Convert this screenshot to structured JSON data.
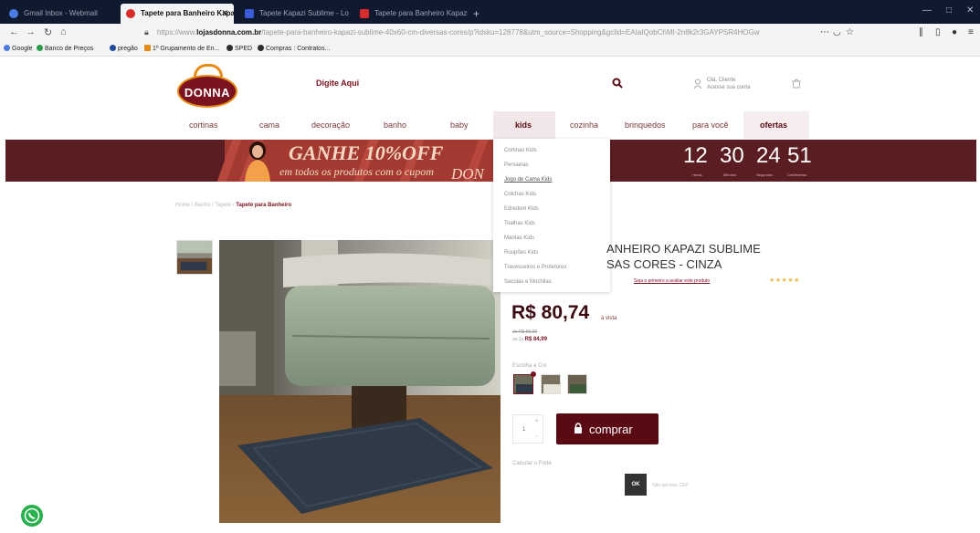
{
  "browser": {
    "tabs": [
      {
        "label": "Gmail Inbox - Webmail",
        "active": false,
        "color": "#4a7be0"
      },
      {
        "label": "Tapete para Banheiro Kapazi",
        "active": true,
        "color": "#d82c2c"
      },
      {
        "label": "Tapete Kapazi Sublime - Loja",
        "active": false,
        "color": "#3b5bdb"
      },
      {
        "label": "Tapete para Banheiro Kapazi",
        "active": false,
        "color": "#d82c2c"
      }
    ],
    "tab_new": "+",
    "url_domain": "lojasdonna.com.br",
    "url_rest": "/tapete-para-banheiro-kapazi-sublime-40x60-cm-diversas-cores/p?idsku=128778&utm_source=Shopping&gclid=EAIaIQobChMI-2n8k2r3GAYPSR4HOGw",
    "bookmarks": [
      {
        "label": "Google",
        "color": "#4a7be0"
      },
      {
        "label": "Banco de Preços",
        "color": "#2a9b4a"
      },
      {
        "label": "pregão",
        "color": "#1f4a9a"
      },
      {
        "label": "1º Grupamento de En...",
        "color": "#e58a13"
      },
      {
        "label": "SPED",
        "color": "#2d2d2d"
      },
      {
        "label": "Compras : Contratos...",
        "color": "#2d2d2d"
      }
    ]
  },
  "header": {
    "logo_text": "DONNA",
    "search_placeholder": "Digite Aqui",
    "account_line1": "Olá, Cliente",
    "account_line2": "Acesse sua conta"
  },
  "menu": [
    "cortinas",
    "cama",
    "decoração",
    "banho",
    "baby",
    "kids",
    "cozinha",
    "brinquedos",
    "para você",
    "ofertas"
  ],
  "banner": {
    "headline": "GANHE 10%OFF",
    "subline": "em todos os produtos com o cupom",
    "brand": "DON",
    "countdown": [
      "12",
      "30",
      "24",
      "51"
    ],
    "countdown_labels": [
      "Horas",
      "Minutos",
      "Segundos",
      "Centésimos"
    ]
  },
  "dropdown": {
    "items": [
      "Cortinas Kids",
      "Persianas",
      "Jogo de Cama Kids",
      "Colchas Kids",
      "Edredom Kids",
      "Toalhas Kids",
      "Mantas Kids",
      "Roupões Kids",
      "Travesseiros e Protetores",
      "Sacolas e Mochilas"
    ],
    "highlighted": 2
  },
  "product": {
    "breadcrumb_prefix": "Home / Banho / Tapete /",
    "breadcrumb_current": "Tapete para Banheiro",
    "title_line1": "ANHEIRO KAPAZI SUBLIME",
    "title_line2": "SAS CORES - CINZA",
    "rating_link": "Seja o primeiro a avaliar este produto",
    "stars": "★★★★★",
    "price": "R$ 80,74",
    "price_suffix": "à vista",
    "old_price": "de R$ 89,90",
    "installments_prefix": "ou 1x",
    "installments_value": "R$ 84,99",
    "color_label": "Escolha a Cor",
    "qty": "1",
    "buy_label": "comprar",
    "cep_label": "Calcular o Frete",
    "ok_label": "OK",
    "cep_link": "Não sei meu CEP"
  },
  "colors": {
    "brand": "#5a0a12",
    "banner": "#5a1d22",
    "accent": "#e58a13"
  }
}
